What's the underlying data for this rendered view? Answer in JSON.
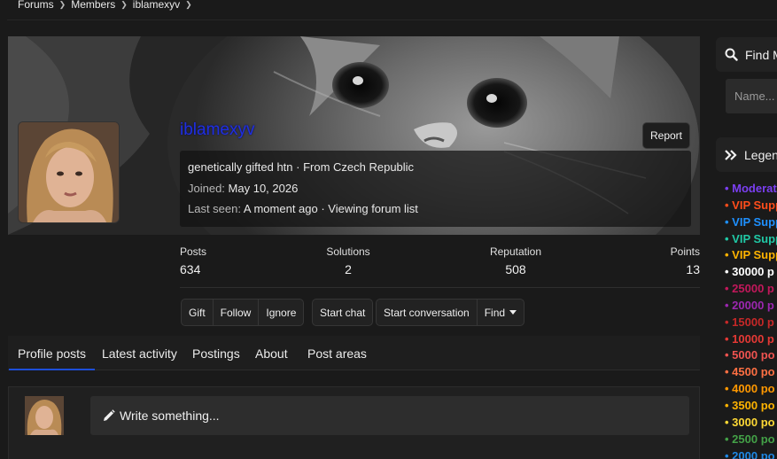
{
  "breadcrumb": [
    "Forums",
    "Members",
    "iblamexyv"
  ],
  "profile": {
    "username": "iblamexyv",
    "report_label": "Report",
    "bio": "genetically gifted htn · From Czech Republic",
    "joined_label": "Joined:",
    "joined_value": "May 10, 2026",
    "last_seen_label": "Last seen:",
    "last_seen_value": "A moment ago · Viewing forum list"
  },
  "stats": [
    {
      "label": "Posts",
      "value": "634"
    },
    {
      "label": "Solutions",
      "value": "2"
    },
    {
      "label": "Reputation",
      "value": "508"
    },
    {
      "label": "Points",
      "value": "13"
    }
  ],
  "actions": {
    "gift": "Gift",
    "follow": "Follow",
    "ignore": "Ignore",
    "start_chat": "Start chat",
    "start_conversation": "Start conversation",
    "find": "Find"
  },
  "tabs": [
    "Profile posts",
    "Latest activity",
    "Postings",
    "About",
    "Post areas"
  ],
  "composer": {
    "placeholder": "Write something..."
  },
  "sidebar": {
    "find_title": "Find M",
    "find_placeholder": "Name...",
    "legend_title": "Legen",
    "legend": [
      {
        "text": "• Moderat",
        "color": "#7b3ff2"
      },
      {
        "text": "• VIP Supp",
        "color": "#ff4d1a"
      },
      {
        "text": "• VIP Supp",
        "color": "#1e90ff"
      },
      {
        "text": "• VIP Supp",
        "color": "#20c9a6"
      },
      {
        "text": "• VIP Supp",
        "color": "#ffb300"
      },
      {
        "text": "• 30000 p",
        "color": "#ffffff"
      },
      {
        "text": "• 25000 p",
        "color": "#c2185b"
      },
      {
        "text": "• 20000 p",
        "color": "#9c27b0"
      },
      {
        "text": "• 15000 p",
        "color": "#c62828"
      },
      {
        "text": "• 10000 p",
        "color": "#e53935"
      },
      {
        "text": "• 5000 po",
        "color": "#ef5350"
      },
      {
        "text": "• 4500 po",
        "color": "#ff7043"
      },
      {
        "text": "• 4000 po",
        "color": "#ff9800"
      },
      {
        "text": "• 3500 po",
        "color": "#ffb300"
      },
      {
        "text": "• 3000 po",
        "color": "#fdd835"
      },
      {
        "text": "• 2500 po",
        "color": "#43a047"
      },
      {
        "text": "• 2000 po",
        "color": "#1e88e5"
      }
    ]
  },
  "colors": {
    "username": "#1f2fe0",
    "accent": "#1d4ed8",
    "background": "#1a1a1a"
  }
}
